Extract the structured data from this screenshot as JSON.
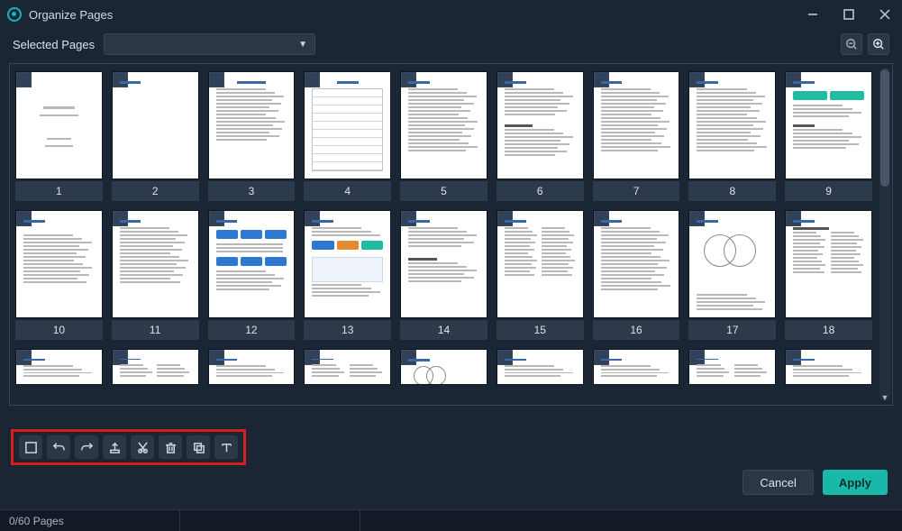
{
  "window": {
    "title": "Organize Pages"
  },
  "filter": {
    "label": "Selected Pages",
    "selected": ""
  },
  "pages": {
    "total": 60,
    "selected": 0,
    "visible_numbers": [
      1,
      2,
      3,
      4,
      5,
      6,
      7,
      8,
      9,
      10,
      11,
      12,
      13,
      14,
      15,
      16,
      17,
      18
    ]
  },
  "toolbar": {
    "items": [
      "select-all",
      "undo",
      "redo",
      "export",
      "cut",
      "delete",
      "copy",
      "text-label"
    ]
  },
  "actions": {
    "cancel": "Cancel",
    "apply": "Apply"
  },
  "status": {
    "pages_label": "0/60 Pages"
  }
}
